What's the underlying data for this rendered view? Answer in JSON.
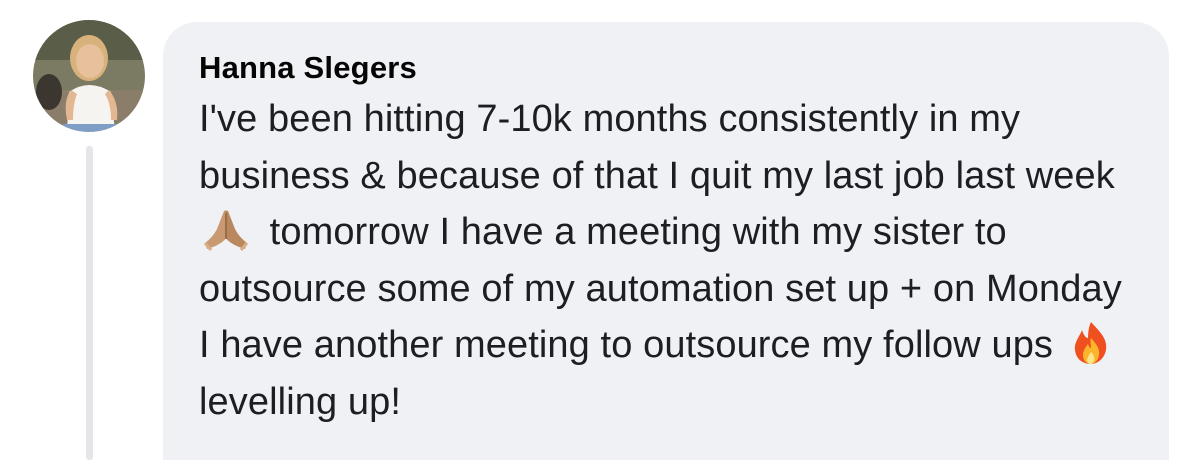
{
  "comment": {
    "author": "Hanna Slegers",
    "text_part1": "I've been hitting 7-10k months consistently in my business & because of that I quit my last job last week",
    "emoji1": "folded-hands-icon",
    "text_part2": "tomorrow I have a meeting with my sister to outsource some of my automation set up + on Monday I have another meeting to outsource my follow ups",
    "emoji2": "fire-icon",
    "text_part3": "levelling up!"
  },
  "colors": {
    "bubble_background": "#f0f1f4",
    "thread_line": "#e4e6ea",
    "author_text": "#050505",
    "body_text": "#1c1e21"
  }
}
